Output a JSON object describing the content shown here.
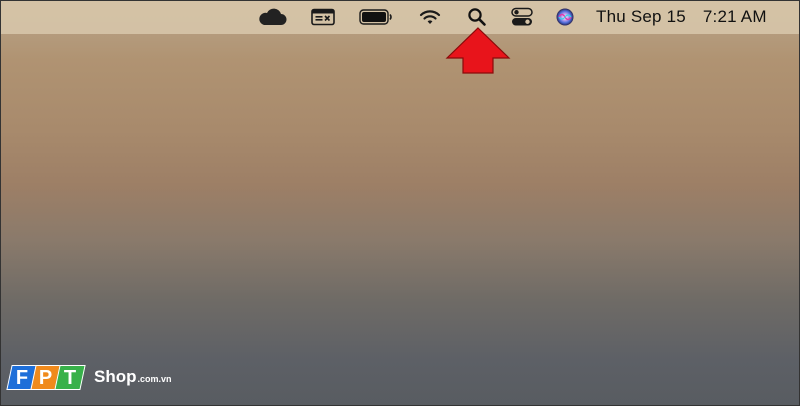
{
  "menubar": {
    "icons": [
      {
        "name": "cloud-icon"
      },
      {
        "name": "screen-capture-icon"
      },
      {
        "name": "battery-icon"
      },
      {
        "name": "wifi-icon"
      },
      {
        "name": "spotlight-search-icon"
      },
      {
        "name": "control-center-icon"
      },
      {
        "name": "siri-icon"
      }
    ],
    "date": "Thu Sep 15",
    "time": "7:21 AM"
  },
  "annotation": {
    "arrow_color": "#e8141b",
    "points_to": "spotlight-search-icon"
  },
  "watermark": {
    "letters": [
      "F",
      "P",
      "T"
    ],
    "tile_colors": [
      "#1e6fd9",
      "#f08a1c",
      "#38b14a"
    ],
    "brand": "Shop",
    "domain": ".com.vn"
  }
}
